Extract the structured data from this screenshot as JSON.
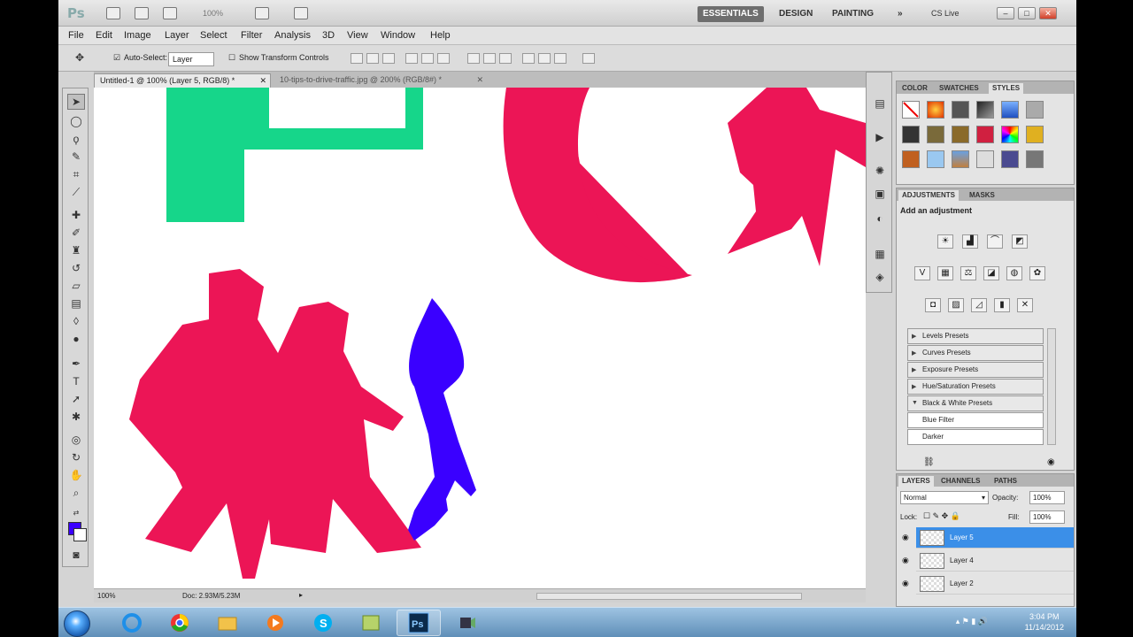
{
  "app": {
    "logo": "Ps",
    "zoom_display": "100%",
    "workspaces": [
      "ESSENTIALS",
      "DESIGN",
      "PAINTING"
    ],
    "more": "»",
    "cs_live": "CS Live"
  },
  "menu": [
    "File",
    "Edit",
    "Image",
    "Layer",
    "Select",
    "Filter",
    "Analysis",
    "3D",
    "View",
    "Window",
    "Help"
  ],
  "options": {
    "auto_select_label": "Auto-Select:",
    "auto_select_value": "Layer",
    "transform_label": "Show Transform Controls"
  },
  "tabs": [
    {
      "label": "Untitled-1 @ 100% (Layer 5, RGB/8) *"
    },
    {
      "label": "10-tips-to-drive-traffic.jpg @ 200% (RGB/8#) *"
    }
  ],
  "status": {
    "zoom": "100%",
    "doc": "Doc: 2.93M/5.23M"
  },
  "styles_panel": {
    "tabs": [
      "COLOR",
      "SWATCHES",
      "STYLES"
    ]
  },
  "adjustments_panel": {
    "tabs": [
      "ADJUSTMENTS",
      "MASKS"
    ],
    "heading": "Add an adjustment",
    "presets": [
      {
        "label": "Levels Presets",
        "expanded": false
      },
      {
        "label": "Curves Presets",
        "expanded": false
      },
      {
        "label": "Exposure Presets",
        "expanded": false
      },
      {
        "label": "Hue/Saturation Presets",
        "expanded": false
      },
      {
        "label": "Black & White Presets",
        "expanded": true
      },
      {
        "label": "Blue Filter",
        "child": true
      },
      {
        "label": "Darker",
        "child": true
      }
    ]
  },
  "layers_panel": {
    "tabs": [
      "LAYERS",
      "CHANNELS",
      "PATHS"
    ],
    "blend_mode": "Normal",
    "opacity_label": "Opacity:",
    "opacity_value": "100%",
    "lock_label": "Lock:",
    "fill_label": "Fill:",
    "fill_value": "100%",
    "layers": [
      {
        "name": "Layer 5",
        "selected": true
      },
      {
        "name": "Layer 4",
        "selected": false
      },
      {
        "name": "Layer 2",
        "selected": false
      }
    ]
  },
  "taskbar": {
    "time": "3:04 PM",
    "date": "11/14/2012"
  },
  "colors": {
    "foreground": "#3a00ff",
    "background": "#ffffff",
    "shape_red": "#ec1556",
    "shape_green": "#16d68a",
    "shape_blue": "#3a00ff",
    "selection": "#3b8fe8"
  }
}
